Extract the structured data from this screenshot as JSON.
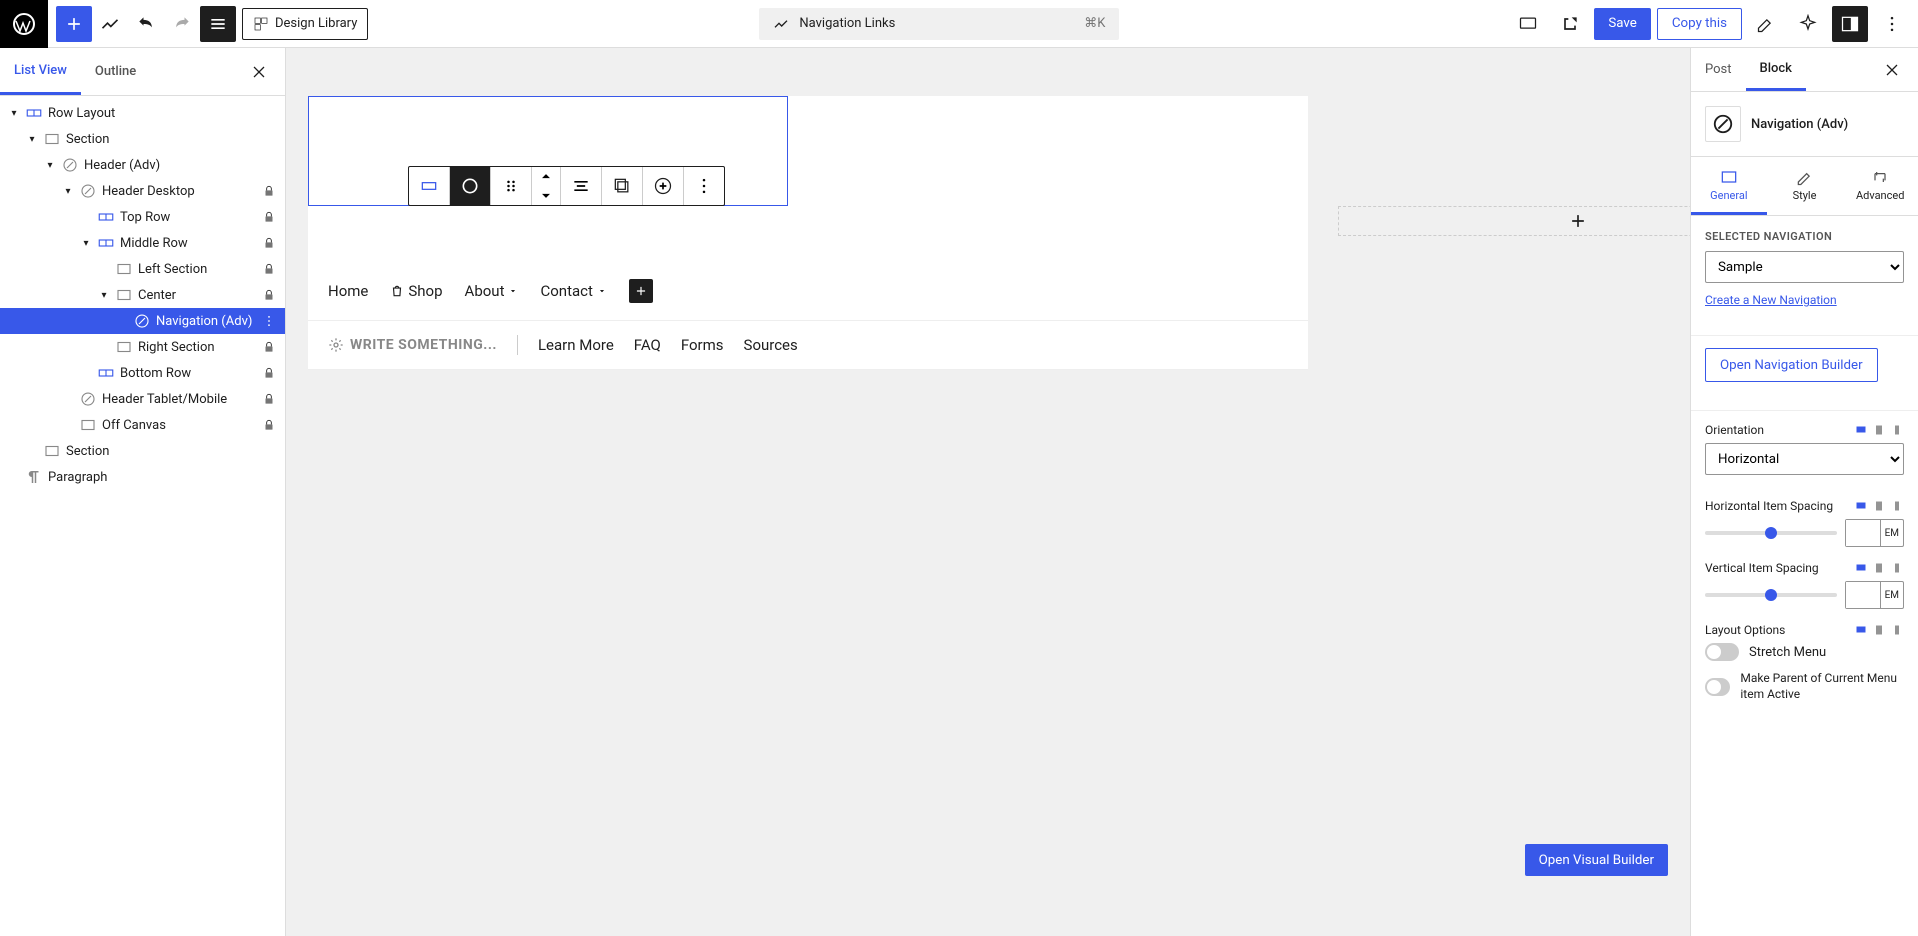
{
  "topbar": {
    "design_library": "Design Library",
    "doc_title": "Navigation Links",
    "shortcut": "⌘K",
    "save": "Save",
    "copy": "Copy this"
  },
  "left": {
    "tabs": {
      "list_view": "List View",
      "outline": "Outline"
    },
    "tree": [
      {
        "label": "Row Layout",
        "depth": 0,
        "open": true,
        "icon": "row",
        "locked": false
      },
      {
        "label": "Section",
        "depth": 1,
        "open": true,
        "icon": "section",
        "locked": false
      },
      {
        "label": "Header (Adv)",
        "depth": 2,
        "open": true,
        "icon": "header",
        "locked": false
      },
      {
        "label": "Header Desktop",
        "depth": 3,
        "open": true,
        "icon": "header",
        "locked": true
      },
      {
        "label": "Top Row",
        "depth": 4,
        "open": false,
        "icon": "row",
        "locked": true
      },
      {
        "label": "Middle Row",
        "depth": 4,
        "open": true,
        "icon": "row",
        "locked": true
      },
      {
        "label": "Left Section",
        "depth": 5,
        "open": false,
        "icon": "section",
        "locked": true
      },
      {
        "label": "Center",
        "depth": 5,
        "open": true,
        "icon": "section",
        "locked": true
      },
      {
        "label": "Navigation (Adv)",
        "depth": 6,
        "open": false,
        "icon": "nav",
        "locked": false,
        "selected": true
      },
      {
        "label": "Right Section",
        "depth": 5,
        "open": false,
        "icon": "section",
        "locked": true
      },
      {
        "label": "Bottom Row",
        "depth": 4,
        "open": false,
        "icon": "row",
        "locked": true
      },
      {
        "label": "Header Tablet/Mobile",
        "depth": 3,
        "open": false,
        "icon": "header",
        "locked": true
      },
      {
        "label": "Off Canvas",
        "depth": 3,
        "open": false,
        "icon": "section",
        "locked": true
      },
      {
        "label": "Section",
        "depth": 1,
        "open": false,
        "icon": "section",
        "locked": false
      },
      {
        "label": "Paragraph",
        "depth": 0,
        "open": false,
        "icon": "paragraph",
        "locked": false
      }
    ]
  },
  "canvas": {
    "nav_items": [
      "Home",
      "Shop",
      "About",
      "Contact"
    ],
    "write_prompt": "WRITE SOMETHING...",
    "sub_links": [
      "Learn More",
      "FAQ",
      "Forms",
      "Sources"
    ],
    "open_visual": "Open Visual Builder"
  },
  "right": {
    "tabs": {
      "post": "Post",
      "block": "Block"
    },
    "block_title": "Navigation (Adv)",
    "inspector_tabs": {
      "general": "General",
      "style": "Style",
      "advanced": "Advanced"
    },
    "selected_nav_label": "SELECTED NAVIGATION",
    "selected_nav_value": "Sample",
    "create_new": "Create a New Navigation",
    "open_builder": "Open Navigation Builder",
    "orientation_label": "Orientation",
    "orientation_value": "Horizontal",
    "h_spacing_label": "Horizontal Item Spacing",
    "v_spacing_label": "Vertical Item Spacing",
    "unit": "EM",
    "layout_label": "Layout Options",
    "stretch": "Stretch Menu",
    "make_parent": "Make Parent of Current Menu item Active"
  }
}
